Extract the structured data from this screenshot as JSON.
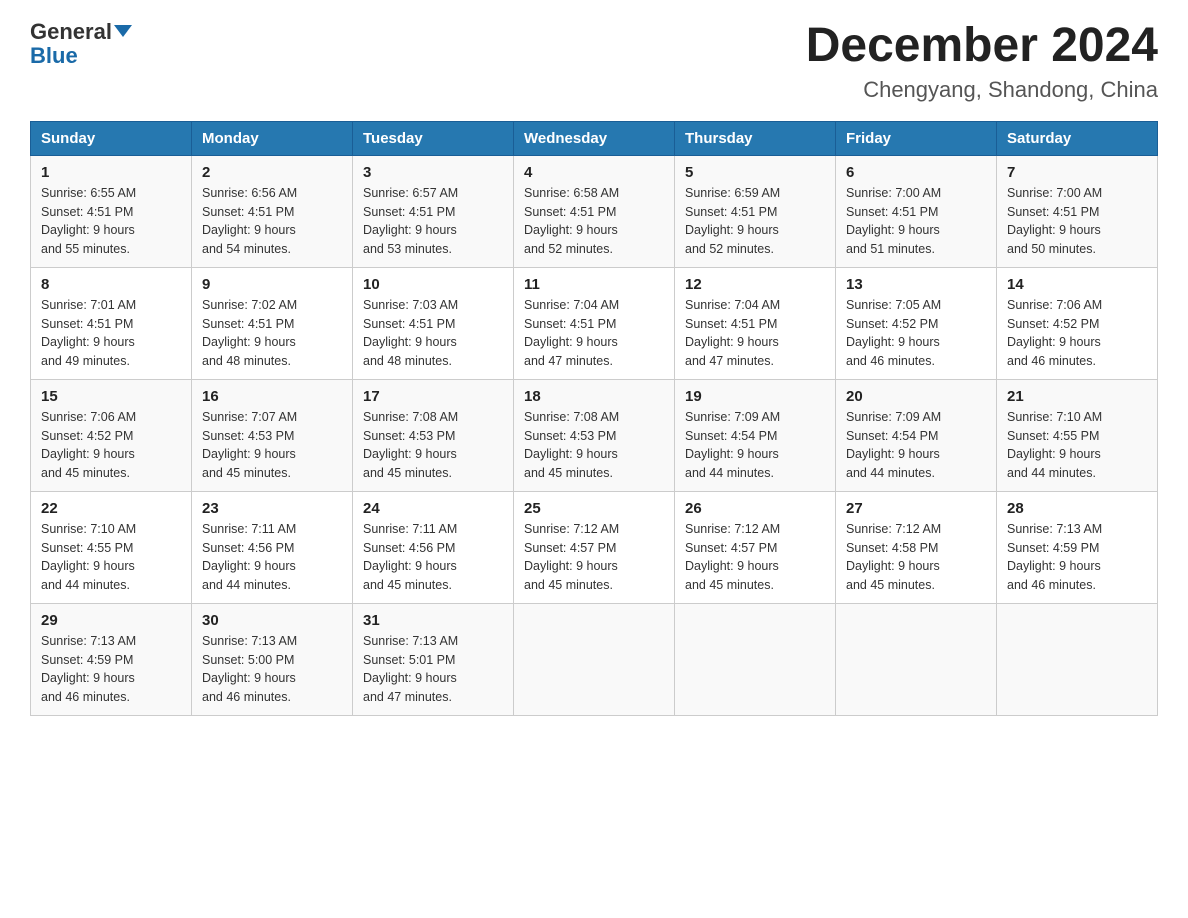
{
  "header": {
    "logo_general": "General",
    "logo_blue": "Blue",
    "title": "December 2024",
    "subtitle": "Chengyang, Shandong, China"
  },
  "columns": [
    "Sunday",
    "Monday",
    "Tuesday",
    "Wednesday",
    "Thursday",
    "Friday",
    "Saturday"
  ],
  "weeks": [
    [
      {
        "day": "1",
        "info": "Sunrise: 6:55 AM\nSunset: 4:51 PM\nDaylight: 9 hours\nand 55 minutes."
      },
      {
        "day": "2",
        "info": "Sunrise: 6:56 AM\nSunset: 4:51 PM\nDaylight: 9 hours\nand 54 minutes."
      },
      {
        "day": "3",
        "info": "Sunrise: 6:57 AM\nSunset: 4:51 PM\nDaylight: 9 hours\nand 53 minutes."
      },
      {
        "day": "4",
        "info": "Sunrise: 6:58 AM\nSunset: 4:51 PM\nDaylight: 9 hours\nand 52 minutes."
      },
      {
        "day": "5",
        "info": "Sunrise: 6:59 AM\nSunset: 4:51 PM\nDaylight: 9 hours\nand 52 minutes."
      },
      {
        "day": "6",
        "info": "Sunrise: 7:00 AM\nSunset: 4:51 PM\nDaylight: 9 hours\nand 51 minutes."
      },
      {
        "day": "7",
        "info": "Sunrise: 7:00 AM\nSunset: 4:51 PM\nDaylight: 9 hours\nand 50 minutes."
      }
    ],
    [
      {
        "day": "8",
        "info": "Sunrise: 7:01 AM\nSunset: 4:51 PM\nDaylight: 9 hours\nand 49 minutes."
      },
      {
        "day": "9",
        "info": "Sunrise: 7:02 AM\nSunset: 4:51 PM\nDaylight: 9 hours\nand 48 minutes."
      },
      {
        "day": "10",
        "info": "Sunrise: 7:03 AM\nSunset: 4:51 PM\nDaylight: 9 hours\nand 48 minutes."
      },
      {
        "day": "11",
        "info": "Sunrise: 7:04 AM\nSunset: 4:51 PM\nDaylight: 9 hours\nand 47 minutes."
      },
      {
        "day": "12",
        "info": "Sunrise: 7:04 AM\nSunset: 4:51 PM\nDaylight: 9 hours\nand 47 minutes."
      },
      {
        "day": "13",
        "info": "Sunrise: 7:05 AM\nSunset: 4:52 PM\nDaylight: 9 hours\nand 46 minutes."
      },
      {
        "day": "14",
        "info": "Sunrise: 7:06 AM\nSunset: 4:52 PM\nDaylight: 9 hours\nand 46 minutes."
      }
    ],
    [
      {
        "day": "15",
        "info": "Sunrise: 7:06 AM\nSunset: 4:52 PM\nDaylight: 9 hours\nand 45 minutes."
      },
      {
        "day": "16",
        "info": "Sunrise: 7:07 AM\nSunset: 4:53 PM\nDaylight: 9 hours\nand 45 minutes."
      },
      {
        "day": "17",
        "info": "Sunrise: 7:08 AM\nSunset: 4:53 PM\nDaylight: 9 hours\nand 45 minutes."
      },
      {
        "day": "18",
        "info": "Sunrise: 7:08 AM\nSunset: 4:53 PM\nDaylight: 9 hours\nand 45 minutes."
      },
      {
        "day": "19",
        "info": "Sunrise: 7:09 AM\nSunset: 4:54 PM\nDaylight: 9 hours\nand 44 minutes."
      },
      {
        "day": "20",
        "info": "Sunrise: 7:09 AM\nSunset: 4:54 PM\nDaylight: 9 hours\nand 44 minutes."
      },
      {
        "day": "21",
        "info": "Sunrise: 7:10 AM\nSunset: 4:55 PM\nDaylight: 9 hours\nand 44 minutes."
      }
    ],
    [
      {
        "day": "22",
        "info": "Sunrise: 7:10 AM\nSunset: 4:55 PM\nDaylight: 9 hours\nand 44 minutes."
      },
      {
        "day": "23",
        "info": "Sunrise: 7:11 AM\nSunset: 4:56 PM\nDaylight: 9 hours\nand 44 minutes."
      },
      {
        "day": "24",
        "info": "Sunrise: 7:11 AM\nSunset: 4:56 PM\nDaylight: 9 hours\nand 45 minutes."
      },
      {
        "day": "25",
        "info": "Sunrise: 7:12 AM\nSunset: 4:57 PM\nDaylight: 9 hours\nand 45 minutes."
      },
      {
        "day": "26",
        "info": "Sunrise: 7:12 AM\nSunset: 4:57 PM\nDaylight: 9 hours\nand 45 minutes."
      },
      {
        "day": "27",
        "info": "Sunrise: 7:12 AM\nSunset: 4:58 PM\nDaylight: 9 hours\nand 45 minutes."
      },
      {
        "day": "28",
        "info": "Sunrise: 7:13 AM\nSunset: 4:59 PM\nDaylight: 9 hours\nand 46 minutes."
      }
    ],
    [
      {
        "day": "29",
        "info": "Sunrise: 7:13 AM\nSunset: 4:59 PM\nDaylight: 9 hours\nand 46 minutes."
      },
      {
        "day": "30",
        "info": "Sunrise: 7:13 AM\nSunset: 5:00 PM\nDaylight: 9 hours\nand 46 minutes."
      },
      {
        "day": "31",
        "info": "Sunrise: 7:13 AM\nSunset: 5:01 PM\nDaylight: 9 hours\nand 47 minutes."
      },
      {
        "day": "",
        "info": ""
      },
      {
        "day": "",
        "info": ""
      },
      {
        "day": "",
        "info": ""
      },
      {
        "day": "",
        "info": ""
      }
    ]
  ]
}
